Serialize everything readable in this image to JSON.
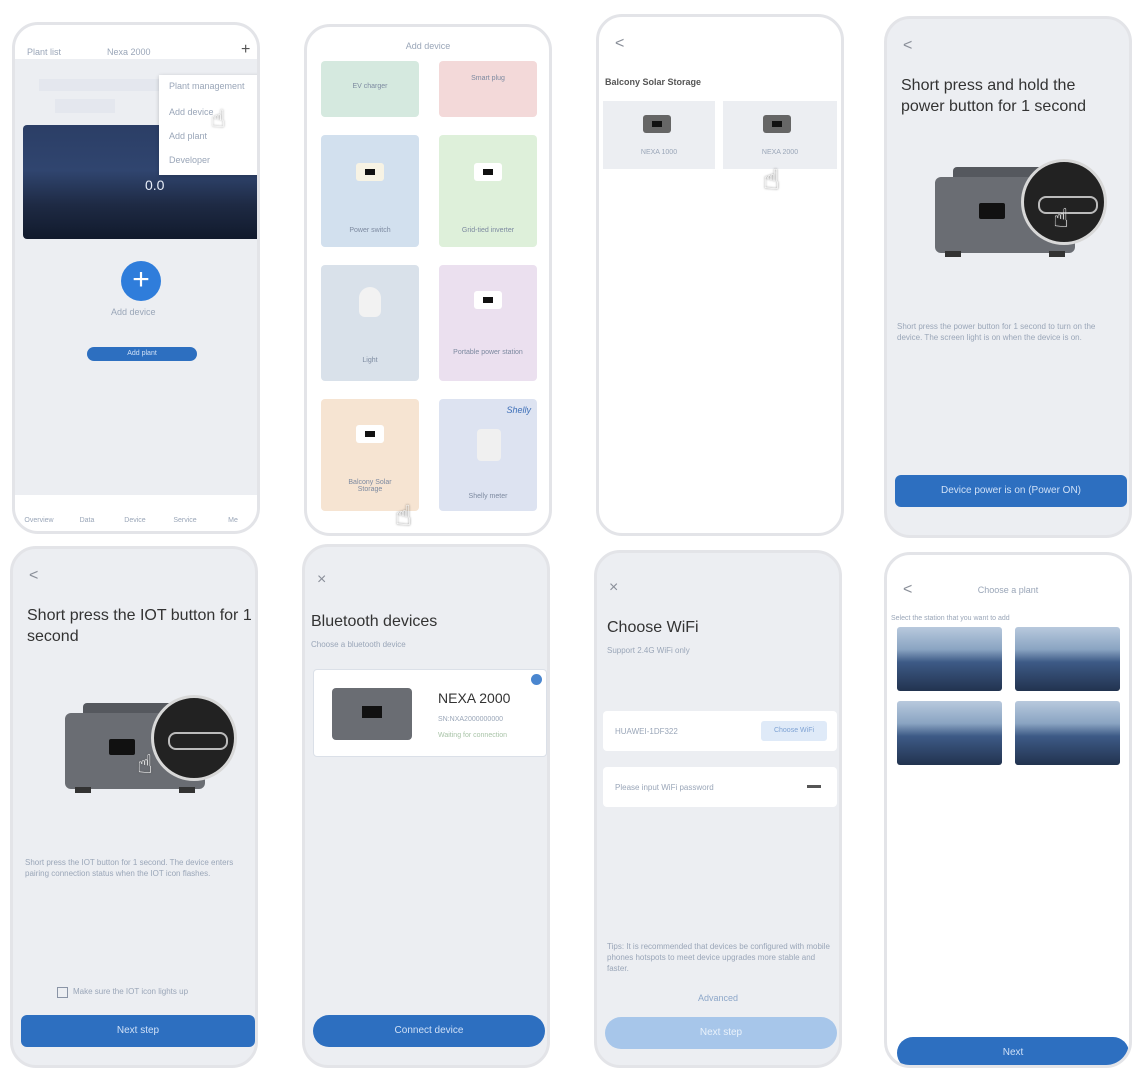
{
  "colors": {
    "accent": "#2d6fc0",
    "accent_light": "#a7c6ea",
    "screen_bg": "#eceef2"
  },
  "s1": {
    "header_left": "Plant list",
    "header_center": "Nexa 2000",
    "plus": "+",
    "menu_items": [
      "Plant management",
      "Add device",
      "Add plant",
      "Developer"
    ],
    "banner_value": "0.0",
    "add_label": "Add device",
    "bottom_button": "Add plant",
    "tabs": [
      "Overview",
      "Data",
      "Device",
      "Service",
      "Me"
    ]
  },
  "s2": {
    "title": "Add device",
    "tiles": [
      "EV charger",
      "Smart plug",
      "Power switch",
      "Grid-tied inverter",
      "Light",
      "Portable power station",
      "Balcony Solar Storage",
      "Shelly meter"
    ],
    "brand": "Shelly"
  },
  "s3": {
    "back": "<",
    "heading": "Balcony Solar Storage",
    "options": [
      "NEXA 1000",
      "NEXA 2000"
    ]
  },
  "s4": {
    "back": "<",
    "title": "Short press and hold the power button for 1 second",
    "desc": "Short press the power button for 1 second to turn on the device. The screen light is on when the device is on.",
    "button": "Device power is on (Power ON)"
  },
  "s5": {
    "back": "<",
    "title": "Short press the IOT button for 1 second",
    "desc": "Short press the IOT button for 1 second. The device enters pairing connection status when the IOT icon flashes.",
    "checkbox": "Make sure the IOT icon lights up",
    "button": "Next step"
  },
  "s6": {
    "close": "×",
    "title": "Bluetooth devices",
    "subtitle": "Choose a bluetooth device",
    "device_name": "NEXA 2000",
    "device_sn": "SN:NXA2000000000",
    "device_status": "Waiting for connection",
    "button": "Connect device"
  },
  "s7": {
    "close": "×",
    "title": "Choose WiFi",
    "subtitle": "Support 2.4G WiFi only",
    "wifi_name": "HUAWEI-1DF322",
    "choose_button": "Choose WiFi",
    "password_placeholder": "Please input WiFi password",
    "note": "Tips: It is recommended that devices be configured with mobile phones hotspots to meet device upgrades more stable and faster.",
    "advanced": "Advanced",
    "button": "Next step"
  },
  "s8": {
    "back": "<",
    "title": "Choose a plant",
    "subtitle": "Select the station that you want to add",
    "button": "Next"
  }
}
